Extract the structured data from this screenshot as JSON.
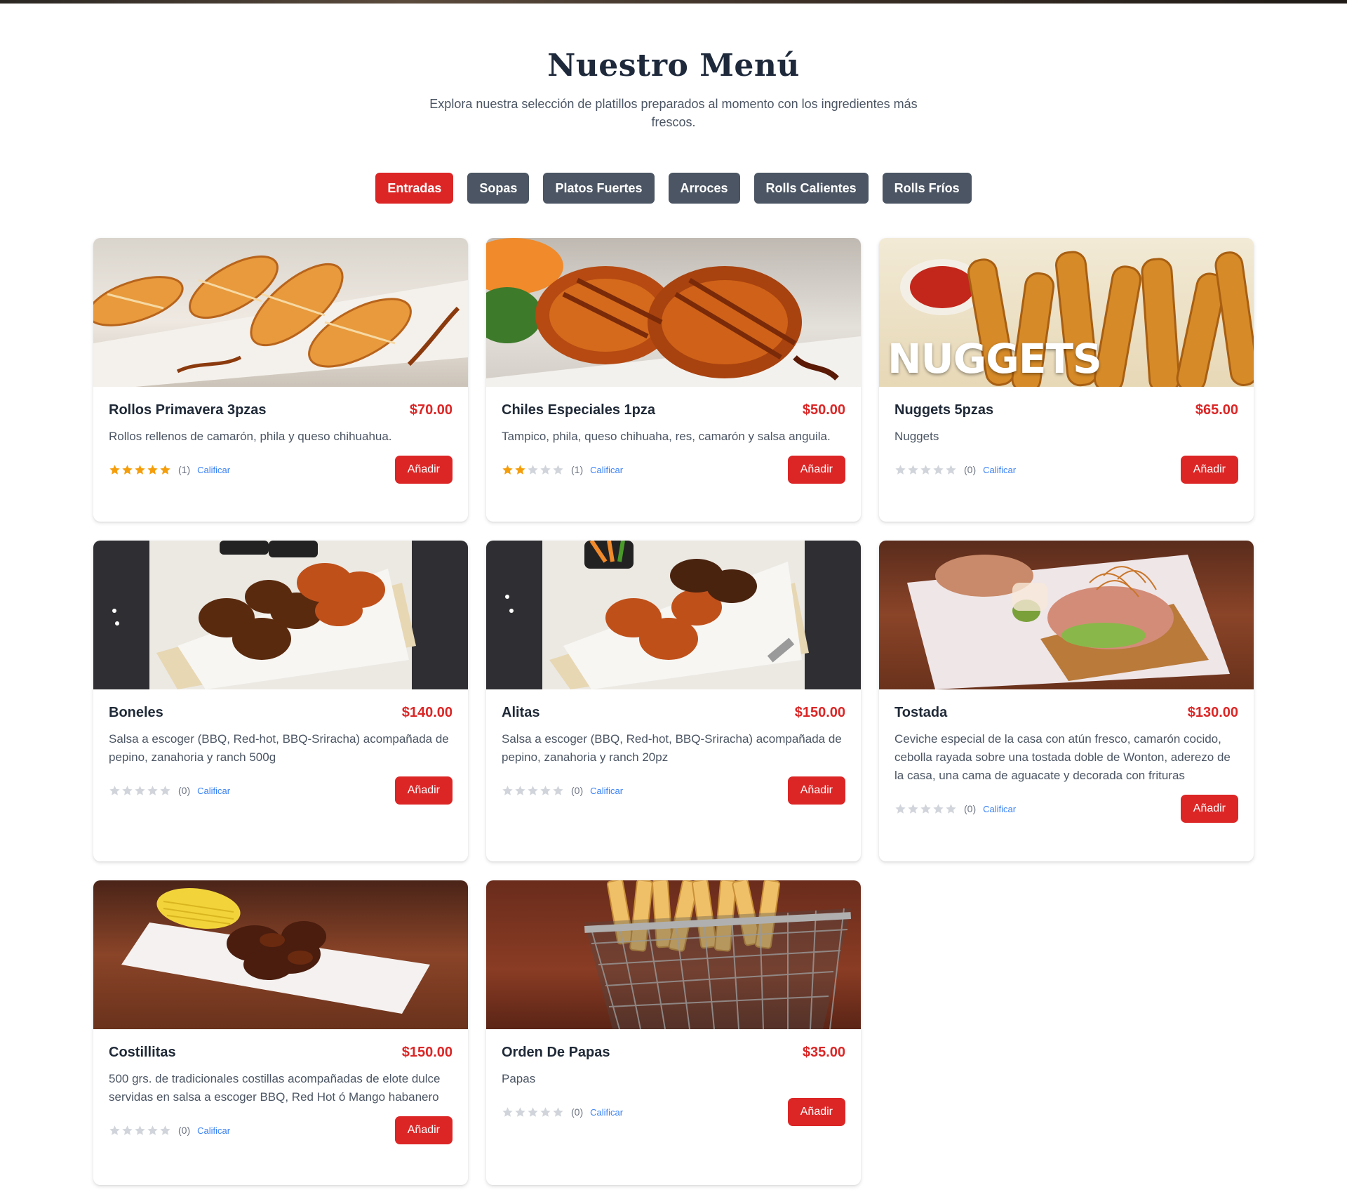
{
  "menu": {
    "title": "Nuestro Menú",
    "subtitle": "Explora nuestra selección de platillos preparados al momento con los ingredientes más frescos."
  },
  "tabs": [
    {
      "label": "Entradas",
      "active": true
    },
    {
      "label": "Sopas",
      "active": false
    },
    {
      "label": "Platos Fuertes",
      "active": false
    },
    {
      "label": "Arroces",
      "active": false
    },
    {
      "label": "Rolls Calientes",
      "active": false
    },
    {
      "label": "Rolls Fríos",
      "active": false
    }
  ],
  "colors": {
    "accent": "#dc2626",
    "tab_inactive": "#4b5563",
    "star_filled": "#f59e0b",
    "star_empty": "#d1d5db",
    "link": "#3b82f6"
  },
  "add_label": "Añadir",
  "rate_label": "Calificar",
  "items": [
    {
      "name": "Rollos Primavera 3pzas",
      "price": "$70.00",
      "description": "Rollos rellenos de camarón, phila y queso chihuahua.",
      "stars": 5,
      "count": "(1)",
      "image_icon": "spring-rolls-photo",
      "image_text": ""
    },
    {
      "name": "Chiles Especiales 1pza",
      "price": "$50.00",
      "description": "Tampico, phila, queso chihuaha, res, camarón y salsa anguila.",
      "stars": 2,
      "count": "(1)",
      "image_icon": "stuffed-chiles-photo",
      "image_text": ""
    },
    {
      "name": "Nuggets 5pzas",
      "price": "$65.00",
      "description": "Nuggets",
      "stars": 0,
      "count": "(0)",
      "image_icon": "nuggets-photo",
      "image_text": "NUGGETS"
    },
    {
      "name": "Boneles",
      "price": "$140.00",
      "description": "Salsa a escoger (BBQ, Red-hot, BBQ-Sriracha) acompañada de pepino, zanahoria y ranch 500g",
      "stars": 0,
      "count": "(0)",
      "image_icon": "boneless-photo",
      "image_text": ""
    },
    {
      "name": "Alitas",
      "price": "$150.00",
      "description": "Salsa a escoger (BBQ, Red-hot, BBQ-Sriracha) acompañada de pepino, zanahoria y ranch 20pz",
      "stars": 0,
      "count": "(0)",
      "image_icon": "wings-photo",
      "image_text": ""
    },
    {
      "name": "Tostada",
      "price": "$130.00",
      "description": "Ceviche especial de la casa con atún fresco, camarón cocido, cebolla rayada sobre una tostada doble de Wonton, aderezo de la casa, una cama de aguacate y decorada con frituras",
      "stars": 0,
      "count": "(0)",
      "image_icon": "tostada-photo",
      "image_text": ""
    },
    {
      "name": "Costillitas",
      "price": "$150.00",
      "description": "500 grs. de tradicionales costillas acompañadas de elote dulce servidas en salsa a escoger BBQ, Red Hot ó Mango habanero",
      "stars": 0,
      "count": "(0)",
      "image_icon": "ribs-photo",
      "image_text": ""
    },
    {
      "name": "Orden De Papas",
      "price": "$35.00",
      "description": "Papas",
      "stars": 0,
      "count": "(0)",
      "image_icon": "fries-photo",
      "image_text": ""
    }
  ]
}
